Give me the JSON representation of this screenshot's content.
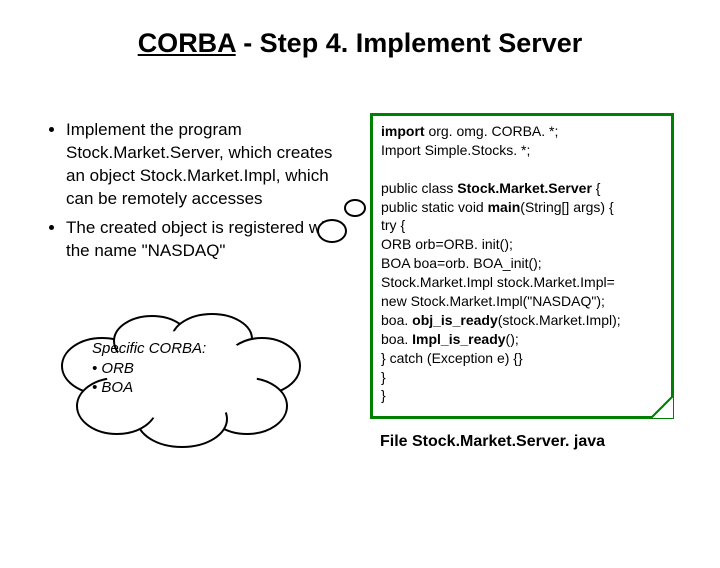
{
  "slide": {
    "title_underlined": "CORBA",
    "title_rest": " - Step 4. Implement Server"
  },
  "bullets": [
    "Implement the program Stock.Market.Server, which creates  an object  Stock.Market.Impl, which can be remotely accesses",
    "The created object is registered  with the name \"NASDAQ\""
  ],
  "cloud": {
    "heading": "Specific CORBA:",
    "items": [
      "ORB",
      "BOA"
    ]
  },
  "code": {
    "l1a": "import",
    "l1b": " org. omg. CORBA. *;",
    "l2": "Import Simple.Stocks. *;",
    "l3a": "public class ",
    "l3b": "Stock.Market.Server",
    "l3c": " {",
    "l4a": "  public static void ",
    "l4b": "main",
    "l4c": "(String[] args) {",
    "l5": "    try {",
    "l6": "     ORB orb=ORB. init();",
    "l7": "     BOA boa=orb. BOA_init();",
    "l8": "     Stock.Market.Impl stock.Market.Impl=",
    "l9": "       new Stock.Market.Impl(\"NASDAQ\");",
    "l10a": "     boa. ",
    "l10b": "obj_is_ready",
    "l10c": "(stock.Market.Impl);",
    "l11a": "     boa. ",
    "l11b": "Impl_is_ready",
    "l11c": "();",
    "l12": "    } catch (Exception e) {}",
    "l13": "   }",
    "l14": "}"
  },
  "caption": "File Stock.Market.Server. java"
}
